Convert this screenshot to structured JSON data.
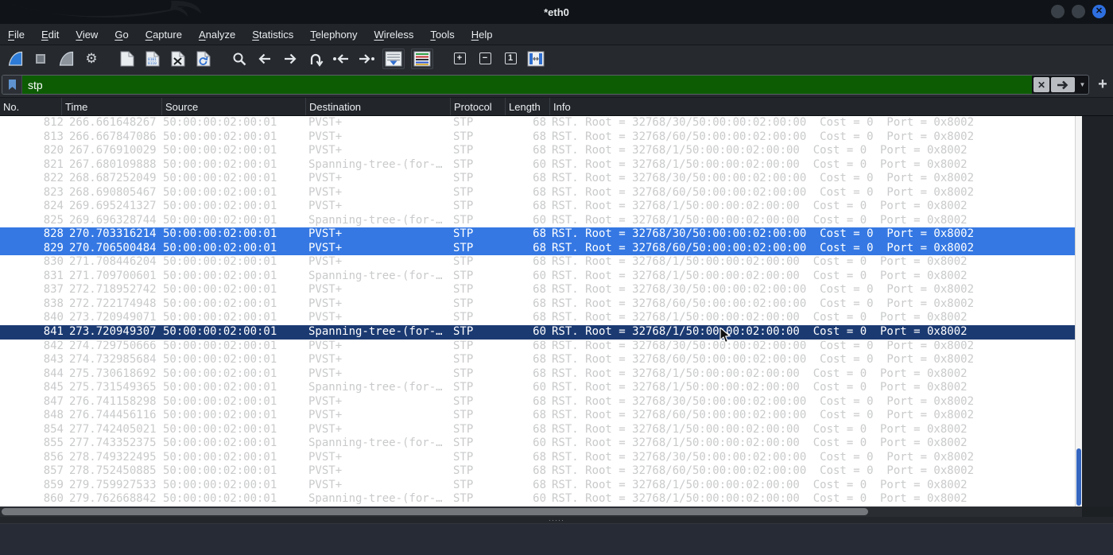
{
  "window": {
    "title": "*eth0",
    "buttons": [
      "minimize-button",
      "maximize-button",
      "close-button"
    ]
  },
  "menu": {
    "items": [
      "File",
      "Edit",
      "View",
      "Go",
      "Capture",
      "Analyze",
      "Statistics",
      "Telephony",
      "Wireless",
      "Tools",
      "Help"
    ]
  },
  "toolbar": {
    "buttons": [
      "start-capture-icon",
      "stop-capture-icon",
      "restart-capture-icon",
      "capture-options-icon",
      "open-file-icon",
      "save-file-icon",
      "close-file-icon",
      "reload-file-icon",
      "find-packet-icon",
      "go-back-icon",
      "go-forward-icon",
      "go-to-packet-icon",
      "previous-packet-icon",
      "next-packet-icon",
      "auto-scroll-icon",
      "colorize-icon",
      "zoom-in-icon",
      "zoom-out-icon",
      "normal-size-icon",
      "resize-columns-icon"
    ]
  },
  "filter": {
    "value": "stp",
    "icons": [
      "bookmark-icon",
      "clear-filter-icon",
      "apply-filter-icon",
      "dropdown-caret-icon",
      "add-filter-icon"
    ],
    "colors": {
      "valid_filter_background": "#0d5c04"
    }
  },
  "colors": {
    "selected_row": "#3578e3",
    "current_row": "#1b3a72",
    "default_row_text": "#c9cacb",
    "accent_blue": "#2e6fe0"
  },
  "packet_table": {
    "columns": [
      "No.",
      "Time",
      "Source",
      "Destination",
      "Protocol",
      "Length",
      "Info"
    ],
    "rows": [
      {
        "no": "812",
        "time": "266.661648267",
        "source": "50:00:00:02:00:01",
        "destination": "PVST+",
        "protocol": "STP",
        "length": "68",
        "info": "RST. Root = 32768/30/50:00:00:02:00:00  Cost = 0  Port = 0x8002",
        "state": "normal"
      },
      {
        "no": "813",
        "time": "266.667847086",
        "source": "50:00:00:02:00:01",
        "destination": "PVST+",
        "protocol": "STP",
        "length": "68",
        "info": "RST. Root = 32768/60/50:00:00:02:00:00  Cost = 0  Port = 0x8002",
        "state": "normal"
      },
      {
        "no": "820",
        "time": "267.676910029",
        "source": "50:00:00:02:00:01",
        "destination": "PVST+",
        "protocol": "STP",
        "length": "68",
        "info": "RST. Root = 32768/1/50:00:00:02:00:00  Cost = 0  Port = 0x8002",
        "state": "normal"
      },
      {
        "no": "821",
        "time": "267.680109888",
        "source": "50:00:00:02:00:01",
        "destination": "Spanning-tree-(for-…",
        "protocol": "STP",
        "length": "60",
        "info": "RST. Root = 32768/1/50:00:00:02:00:00  Cost = 0  Port = 0x8002",
        "state": "normal"
      },
      {
        "no": "822",
        "time": "268.687252049",
        "source": "50:00:00:02:00:01",
        "destination": "PVST+",
        "protocol": "STP",
        "length": "68",
        "info": "RST. Root = 32768/30/50:00:00:02:00:00  Cost = 0  Port = 0x8002",
        "state": "normal"
      },
      {
        "no": "823",
        "time": "268.690805467",
        "source": "50:00:00:02:00:01",
        "destination": "PVST+",
        "protocol": "STP",
        "length": "68",
        "info": "RST. Root = 32768/60/50:00:00:02:00:00  Cost = 0  Port = 0x8002",
        "state": "normal"
      },
      {
        "no": "824",
        "time": "269.695241327",
        "source": "50:00:00:02:00:01",
        "destination": "PVST+",
        "protocol": "STP",
        "length": "68",
        "info": "RST. Root = 32768/1/50:00:00:02:00:00  Cost = 0  Port = 0x8002",
        "state": "normal"
      },
      {
        "no": "825",
        "time": "269.696328744",
        "source": "50:00:00:02:00:01",
        "destination": "Spanning-tree-(for-…",
        "protocol": "STP",
        "length": "60",
        "info": "RST. Root = 32768/1/50:00:00:02:00:00  Cost = 0  Port = 0x8002",
        "state": "normal"
      },
      {
        "no": "828",
        "time": "270.703316214",
        "source": "50:00:00:02:00:01",
        "destination": "PVST+",
        "protocol": "STP",
        "length": "68",
        "info": "RST. Root = 32768/30/50:00:00:02:00:00  Cost = 0  Port = 0x8002",
        "state": "selected"
      },
      {
        "no": "829",
        "time": "270.706500484",
        "source": "50:00:00:02:00:01",
        "destination": "PVST+",
        "protocol": "STP",
        "length": "68",
        "info": "RST. Root = 32768/60/50:00:00:02:00:00  Cost = 0  Port = 0x8002",
        "state": "selected"
      },
      {
        "no": "830",
        "time": "271.708446204",
        "source": "50:00:00:02:00:01",
        "destination": "PVST+",
        "protocol": "STP",
        "length": "68",
        "info": "RST. Root = 32768/1/50:00:00:02:00:00  Cost = 0  Port = 0x8002",
        "state": "normal"
      },
      {
        "no": "831",
        "time": "271.709700601",
        "source": "50:00:00:02:00:01",
        "destination": "Spanning-tree-(for-…",
        "protocol": "STP",
        "length": "60",
        "info": "RST. Root = 32768/1/50:00:00:02:00:00  Cost = 0  Port = 0x8002",
        "state": "normal"
      },
      {
        "no": "837",
        "time": "272.718952742",
        "source": "50:00:00:02:00:01",
        "destination": "PVST+",
        "protocol": "STP",
        "length": "68",
        "info": "RST. Root = 32768/30/50:00:00:02:00:00  Cost = 0  Port = 0x8002",
        "state": "normal"
      },
      {
        "no": "838",
        "time": "272.722174948",
        "source": "50:00:00:02:00:01",
        "destination": "PVST+",
        "protocol": "STP",
        "length": "68",
        "info": "RST. Root = 32768/60/50:00:00:02:00:00  Cost = 0  Port = 0x8002",
        "state": "normal"
      },
      {
        "no": "840",
        "time": "273.720949071",
        "source": "50:00:00:02:00:01",
        "destination": "PVST+",
        "protocol": "STP",
        "length": "68",
        "info": "RST. Root = 32768/1/50:00:00:02:00:00  Cost = 0  Port = 0x8002",
        "state": "normal"
      },
      {
        "no": "841",
        "time": "273.720949307",
        "source": "50:00:00:02:00:01",
        "destination": "Spanning-tree-(for-…",
        "protocol": "STP",
        "length": "60",
        "info": "RST. Root = 32768/1/50:00:00:02:00:00  Cost = 0  Port = 0x8002",
        "state": "current"
      },
      {
        "no": "842",
        "time": "274.729750666",
        "source": "50:00:00:02:00:01",
        "destination": "PVST+",
        "protocol": "STP",
        "length": "68",
        "info": "RST. Root = 32768/30/50:00:00:02:00:00  Cost = 0  Port = 0x8002",
        "state": "normal"
      },
      {
        "no": "843",
        "time": "274.732985684",
        "source": "50:00:00:02:00:01",
        "destination": "PVST+",
        "protocol": "STP",
        "length": "68",
        "info": "RST. Root = 32768/60/50:00:00:02:00:00  Cost = 0  Port = 0x8002",
        "state": "normal"
      },
      {
        "no": "844",
        "time": "275.730618692",
        "source": "50:00:00:02:00:01",
        "destination": "PVST+",
        "protocol": "STP",
        "length": "68",
        "info": "RST. Root = 32768/1/50:00:00:02:00:00  Cost = 0  Port = 0x8002",
        "state": "normal"
      },
      {
        "no": "845",
        "time": "275.731549365",
        "source": "50:00:00:02:00:01",
        "destination": "Spanning-tree-(for-…",
        "protocol": "STP",
        "length": "60",
        "info": "RST. Root = 32768/1/50:00:00:02:00:00  Cost = 0  Port = 0x8002",
        "state": "normal"
      },
      {
        "no": "847",
        "time": "276.741158298",
        "source": "50:00:00:02:00:01",
        "destination": "PVST+",
        "protocol": "STP",
        "length": "68",
        "info": "RST. Root = 32768/30/50:00:00:02:00:00  Cost = 0  Port = 0x8002",
        "state": "normal"
      },
      {
        "no": "848",
        "time": "276.744456116",
        "source": "50:00:00:02:00:01",
        "destination": "PVST+",
        "protocol": "STP",
        "length": "68",
        "info": "RST. Root = 32768/60/50:00:00:02:00:00  Cost = 0  Port = 0x8002",
        "state": "normal"
      },
      {
        "no": "854",
        "time": "277.742405021",
        "source": "50:00:00:02:00:01",
        "destination": "PVST+",
        "protocol": "STP",
        "length": "68",
        "info": "RST. Root = 32768/1/50:00:00:02:00:00  Cost = 0  Port = 0x8002",
        "state": "normal"
      },
      {
        "no": "855",
        "time": "277.743352375",
        "source": "50:00:00:02:00:01",
        "destination": "Spanning-tree-(for-…",
        "protocol": "STP",
        "length": "60",
        "info": "RST. Root = 32768/1/50:00:00:02:00:00  Cost = 0  Port = 0x8002",
        "state": "normal"
      },
      {
        "no": "856",
        "time": "278.749322495",
        "source": "50:00:00:02:00:01",
        "destination": "PVST+",
        "protocol": "STP",
        "length": "68",
        "info": "RST. Root = 32768/30/50:00:00:02:00:00  Cost = 0  Port = 0x8002",
        "state": "normal"
      },
      {
        "no": "857",
        "time": "278.752450885",
        "source": "50:00:00:02:00:01",
        "destination": "PVST+",
        "protocol": "STP",
        "length": "68",
        "info": "RST. Root = 32768/60/50:00:00:02:00:00  Cost = 0  Port = 0x8002",
        "state": "normal"
      },
      {
        "no": "859",
        "time": "279.759927533",
        "source": "50:00:00:02:00:01",
        "destination": "PVST+",
        "protocol": "STP",
        "length": "68",
        "info": "RST. Root = 32768/1/50:00:00:02:00:00  Cost = 0  Port = 0x8002",
        "state": "normal"
      },
      {
        "no": "860",
        "time": "279.762668842",
        "source": "50:00:00:02:00:01",
        "destination": "Spanning-tree-(for-…",
        "protocol": "STP",
        "length": "60",
        "info": "RST. Root = 32768/1/50:00:00:02:00:00  Cost = 0  Port = 0x8002",
        "state": "normal"
      }
    ]
  }
}
